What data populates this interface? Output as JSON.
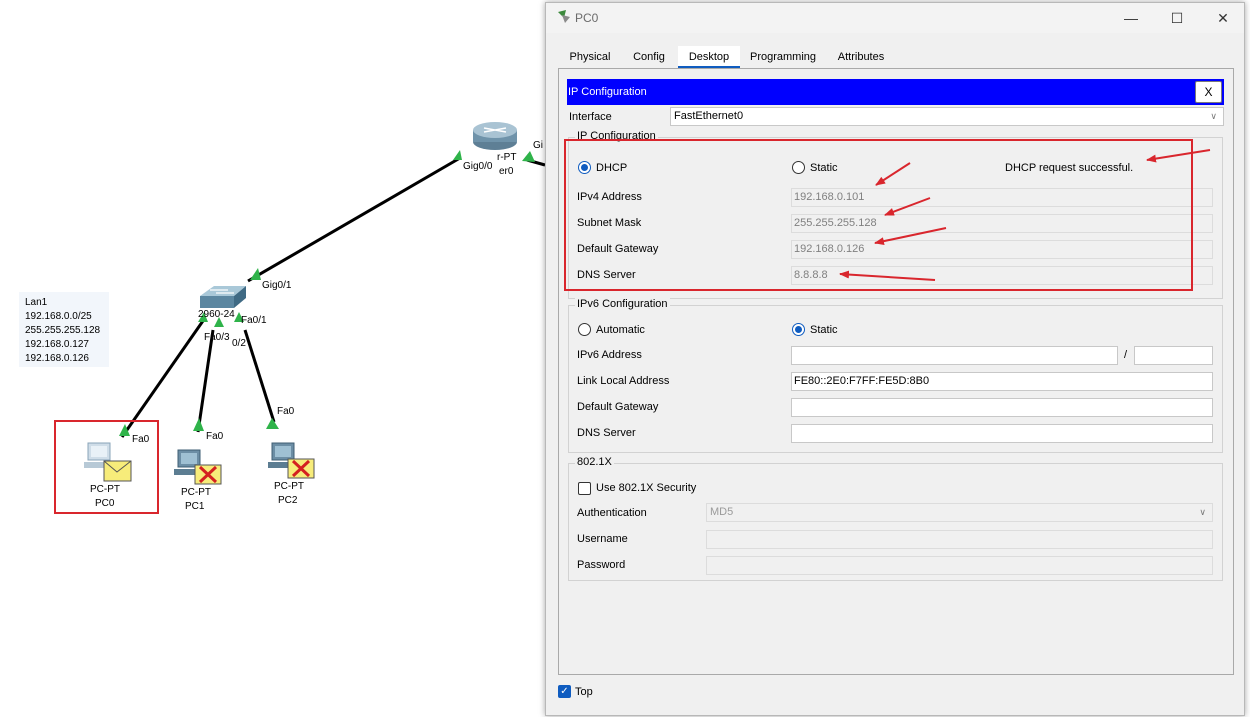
{
  "topology": {
    "router_label_1": "r-PT",
    "router_label_2": "er0",
    "router_port_gig00": "Gig0/0",
    "router_port_right": "Gi",
    "switch_port_gig01": "Gig0/1",
    "switch_label": "2960-24",
    "switch_port_fa01": "Fa0/1",
    "switch_port_fa03": "Fa0/3",
    "switch_port_fa02": "0/2",
    "pc0_port": "Fa0",
    "pc1_port": "Fa0",
    "pc2_port": "Fa0",
    "pc0_type": "PC-PT",
    "pc0_name": "PC0",
    "pc1_type": "PC-PT",
    "pc1_name": "PC1",
    "pc2_type": "PC-PT",
    "pc2_name": "PC2",
    "note_lines": [
      "Lan1",
      "192.168.0.0/25",
      "255.255.255.128",
      "192.168.0.127",
      "192.168.0.126"
    ]
  },
  "window": {
    "title": "PC0",
    "controls": {
      "minimize": "—",
      "maximize": "☐",
      "close": "✕"
    }
  },
  "tabs": [
    {
      "label": "Physical",
      "active": false
    },
    {
      "label": "Config",
      "active": false
    },
    {
      "label": "Desktop",
      "active": true
    },
    {
      "label": "Programming",
      "active": false
    },
    {
      "label": "Attributes",
      "active": false
    }
  ],
  "ipconfig": {
    "header": "IP Configuration",
    "close_label": "X",
    "interface_label": "Interface",
    "interface_value": "FastEthernet0",
    "ipv4_group_label": "IP Configuration",
    "dhcp_label": "DHCP",
    "static_label": "Static",
    "mode": "DHCP",
    "status_text": "DHCP request successful.",
    "ipv4_address_label": "IPv4 Address",
    "ipv4_address": "192.168.0.101",
    "subnet_mask_label": "Subnet Mask",
    "subnet_mask": "255.255.255.128",
    "default_gateway_label": "Default Gateway",
    "default_gateway": "192.168.0.126",
    "dns_server_label": "DNS Server",
    "dns_server": "8.8.8.8"
  },
  "ipv6": {
    "group_label": "IPv6 Configuration",
    "automatic_label": "Automatic",
    "static_label": "Static",
    "mode": "Static",
    "ipv6_address_label": "IPv6 Address",
    "ipv6_address": "",
    "prefix_separator": "/",
    "prefix_length": "",
    "link_local_label": "Link Local Address",
    "link_local": "FE80::2E0:F7FF:FE5D:8B0",
    "default_gateway_label": "Default Gateway",
    "default_gateway": "",
    "dns_server_label": "DNS Server",
    "dns_server": ""
  },
  "dot1x": {
    "group_label": "802.1X",
    "use_label": "Use 802.1X Security",
    "use_checked": false,
    "authentication_label": "Authentication",
    "authentication_value": "MD5",
    "username_label": "Username",
    "username": "",
    "password_label": "Password",
    "password": ""
  },
  "footer": {
    "top_label": "Top",
    "top_checked": true
  },
  "colors": {
    "header_blue": "#0000ff",
    "accent": "#0f5cc0",
    "annotation_red": "#d9262d",
    "link_green": "#2fb34a"
  }
}
